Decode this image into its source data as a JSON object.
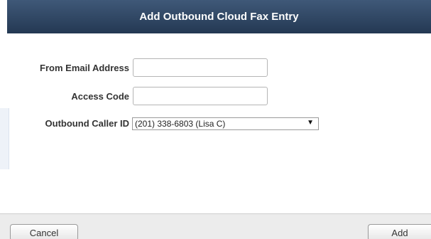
{
  "dialog": {
    "title": "Add Outbound Cloud Fax Entry"
  },
  "form": {
    "from_email": {
      "label": "From Email Address",
      "value": "",
      "placeholder": ""
    },
    "access_code": {
      "label": "Access Code",
      "value": "",
      "placeholder": ""
    },
    "outbound_caller_id": {
      "label": "Outbound Caller ID",
      "selected": "(201) 338-6803 (Lisa C)",
      "arrow_icon": "dropdown-triangle-icon"
    }
  },
  "footer": {
    "cancel_label": "Cancel",
    "add_label": "Add"
  },
  "colors": {
    "title_bar": "#2f4664",
    "title_text": "#ffffff",
    "footer_bg": "#ececec"
  }
}
